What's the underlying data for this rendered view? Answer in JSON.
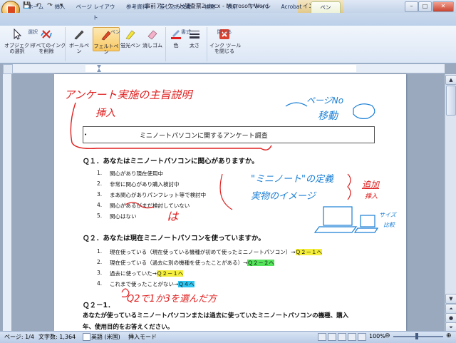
{
  "window": {
    "title": "事前アンケート調査票2.docx - Microsoft Word",
    "contextual_tab": "インク ツール",
    "minimize": "–",
    "maximize": "□",
    "close": "✕"
  },
  "quick_access": {
    "save": "💾",
    "undo": "↶",
    "redo": "↷",
    "more": "▾"
  },
  "tabs": [
    "ホーム",
    "挿入",
    "ページ レイアウト",
    "参考資料",
    "差し込み文書",
    "校閲",
    "表示",
    "アドイン",
    "Acrobat",
    "ペン"
  ],
  "ribbon": {
    "select_object": "オブジェクト\nの選択",
    "delete_all_ink": "すべてのインク\nを削除",
    "ballpoint": "ボールペン",
    "felt_pen": "フェルトペン",
    "highlighter": "蛍光ペン",
    "eraser": "消しゴム",
    "color": "色",
    "thickness": "太さ",
    "close_ink": "インク ツール\nを閉じる",
    "groups": {
      "select": "選択",
      "pen": "ペン",
      "format": "書式",
      "close": "閉じる"
    }
  },
  "document": {
    "title_line": "ミニノートパソコンに関するアンケート調査",
    "q1": "Ｑ１．あなたはミニノートパソコンに関心がありますか。",
    "q1_options": [
      {
        "num": "1.",
        "text": "関心があり現在使用中"
      },
      {
        "num": "2.",
        "text": "非常に関心があり購入検討中"
      },
      {
        "num": "3.",
        "text": "まあ関心がありパンフレット等で検討中"
      },
      {
        "num": "4.",
        "text": "関心があるがまだ検討していない"
      },
      {
        "num": "5.",
        "text": "関心はない"
      }
    ],
    "q2": "Ｑ２．あなたは現在ミニノートパソコンを使っていますか。",
    "q2_options": [
      {
        "num": "1.",
        "text": "現在使っている（現在使っている機種が初めて使ったミニノートパソコン）→",
        "jump": "Ｑ２－１へ"
      },
      {
        "num": "2.",
        "text": "現在使っている（過去に別の機種を使ったことがある）→",
        "jump": "Ｑ２－２へ"
      },
      {
        "num": "3.",
        "text": "過去に使っていた→",
        "jump": "Ｑ２－１へ"
      },
      {
        "num": "4.",
        "text": "これまで使ったことがない→",
        "jump": "Ｑ４へ"
      }
    ],
    "q21": "Ｑ２－1．",
    "q21_text": "あなたが使っているミニノートパソコンまたは過去に使っていたミニノートパソコンの機種、購入",
    "q21_text2": "年、使用目的をお答えください。"
  },
  "ink": {
    "a1": "アンケート実施の主旨説明",
    "a2": "挿入",
    "a3": "ページNo",
    "a4": "移動",
    "a5": "\"ミニノート\"の定義",
    "a6": "実物のイメージ",
    "a7": "追加",
    "a8": "挿入",
    "a9": "サイズ",
    "a10": "比較",
    "a11": "は",
    "a12": "Q2で1か3を選んだ方"
  },
  "statusbar": {
    "page": "ページ: 1/4",
    "words": "文字数: 1,364",
    "language": "英語 (米国)",
    "mode": "挿入モード",
    "zoom": "100%"
  },
  "colors": {
    "ink_red": "#e02020",
    "ink_blue": "#1a7fd6"
  }
}
